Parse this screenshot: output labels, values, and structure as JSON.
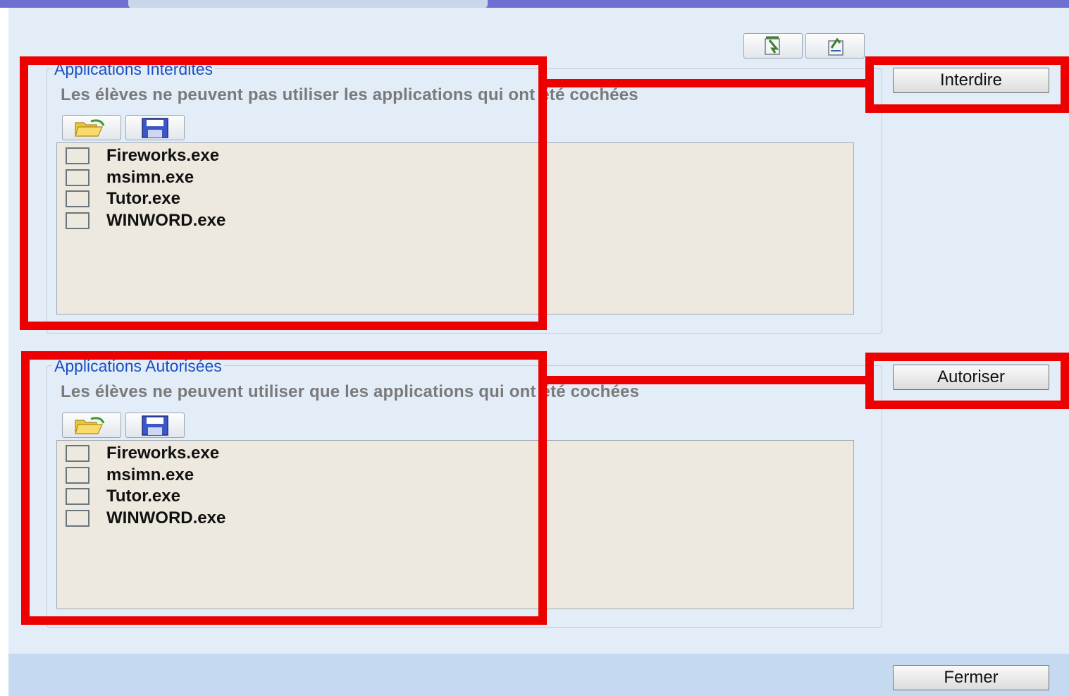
{
  "colors": {
    "annotation": "#ec0000",
    "legend_text": "#1a4fc2",
    "list_bg": "#ede9df"
  },
  "toolbar": {
    "icons": [
      "import-icon",
      "export-icon"
    ]
  },
  "forbidden": {
    "legend": "Applications Interdites",
    "description": "Les élèves ne peuvent pas utiliser les applications qui ont été cochées",
    "items": [
      "Fireworks.exe",
      "msimn.exe",
      "Tutor.exe",
      "WINWORD.exe"
    ],
    "button_label": "Interdire"
  },
  "allowed": {
    "legend": "Applications Autorisées",
    "description": "Les élèves ne peuvent utiliser que les applications qui ont été cochées",
    "items": [
      "Fireworks.exe",
      "msimn.exe",
      "Tutor.exe",
      "WINWORD.exe"
    ],
    "button_label": "Autoriser"
  },
  "footer": {
    "close_label": "Fermer"
  }
}
